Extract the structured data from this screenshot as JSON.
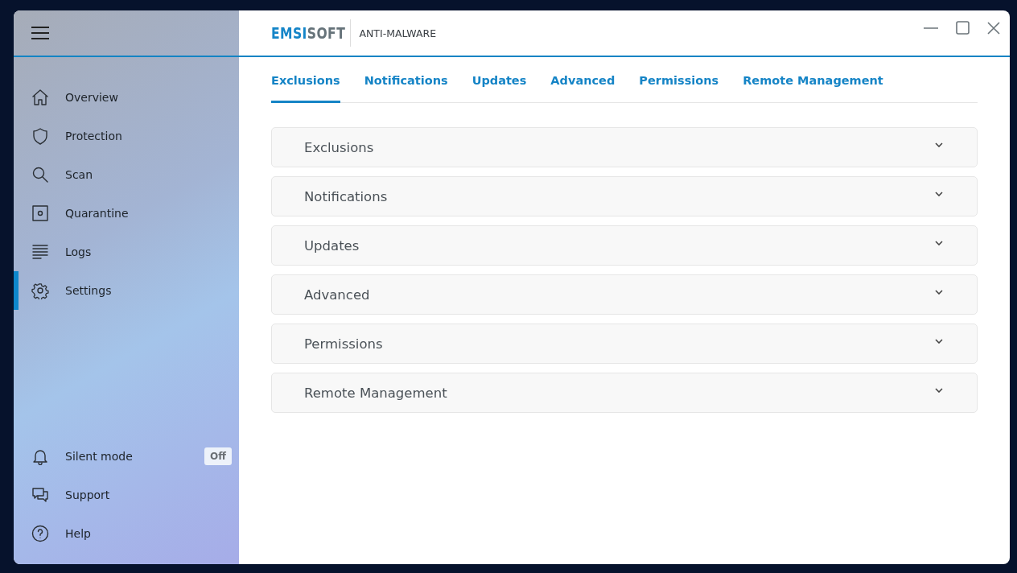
{
  "logo": {
    "parts": [
      "EMSI",
      "SOFT"
    ]
  },
  "product": "ANTI-MALWARE",
  "sidebar": {
    "items": [
      {
        "label": "Overview",
        "selected": false
      },
      {
        "label": "Protection",
        "selected": false
      },
      {
        "label": "Scan",
        "selected": false
      },
      {
        "label": "Quarantine",
        "selected": false
      },
      {
        "label": "Logs",
        "selected": false
      },
      {
        "label": "Settings",
        "selected": true
      }
    ],
    "bottom_items": [
      {
        "label": "Silent mode",
        "badge": "Off"
      },
      {
        "label": "Support"
      },
      {
        "label": "Help"
      }
    ]
  },
  "tabs": [
    {
      "label": "Exclusions",
      "selected": true
    },
    {
      "label": "Notifications",
      "selected": false
    },
    {
      "label": "Updates",
      "selected": false
    },
    {
      "label": "Advanced",
      "selected": false
    },
    {
      "label": "Permissions",
      "selected": false
    },
    {
      "label": "Remote Management",
      "selected": false
    }
  ],
  "sections": [
    {
      "title": "Exclusions",
      "expanded": false
    },
    {
      "title": "Notifications",
      "expanded": false
    },
    {
      "title": "Updates",
      "expanded": false
    },
    {
      "title": "Advanced",
      "expanded": false
    },
    {
      "title": "Permissions",
      "expanded": false
    },
    {
      "title": "Remote Management",
      "expanded": false
    }
  ]
}
